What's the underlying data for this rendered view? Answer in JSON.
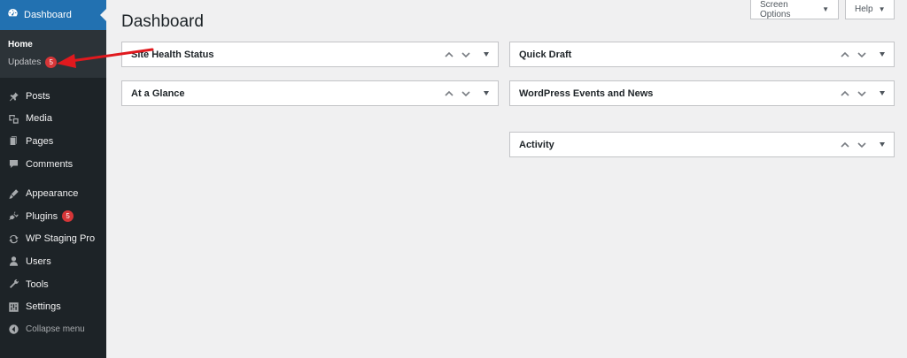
{
  "sidebar": {
    "current": {
      "label": "Dashboard",
      "icon": "dashboard-icon"
    },
    "submenu": [
      {
        "label": "Home",
        "active": true
      },
      {
        "label": "Updates",
        "badge": "5"
      }
    ],
    "items": [
      {
        "label": "Posts",
        "icon": "pushpin-icon"
      },
      {
        "label": "Media",
        "icon": "media-icon"
      },
      {
        "label": "Pages",
        "icon": "pages-icon"
      },
      {
        "label": "Comments",
        "icon": "comments-icon"
      },
      {
        "label": "Appearance",
        "icon": "appearance-icon"
      },
      {
        "label": "Plugins",
        "icon": "plugins-icon",
        "badge": "5"
      },
      {
        "label": "WP Staging Pro",
        "icon": "sync-icon"
      },
      {
        "label": "Users",
        "icon": "users-icon"
      },
      {
        "label": "Tools",
        "icon": "wrench-icon"
      },
      {
        "label": "Settings",
        "icon": "settings-icon"
      },
      {
        "label": "Collapse menu",
        "icon": "collapse-icon"
      }
    ]
  },
  "header": {
    "title": "Dashboard",
    "screen_options": "Screen Options",
    "help": "Help"
  },
  "widgets": {
    "left": [
      "Site Health Status",
      "At a Glance"
    ],
    "right": [
      "Quick Draft",
      "WordPress Events and News",
      "Activity"
    ]
  },
  "colors": {
    "sidebar_bg": "#1d2327",
    "accent": "#2271b1",
    "badge": "#d63638",
    "annotation_arrow": "#e0191e"
  }
}
